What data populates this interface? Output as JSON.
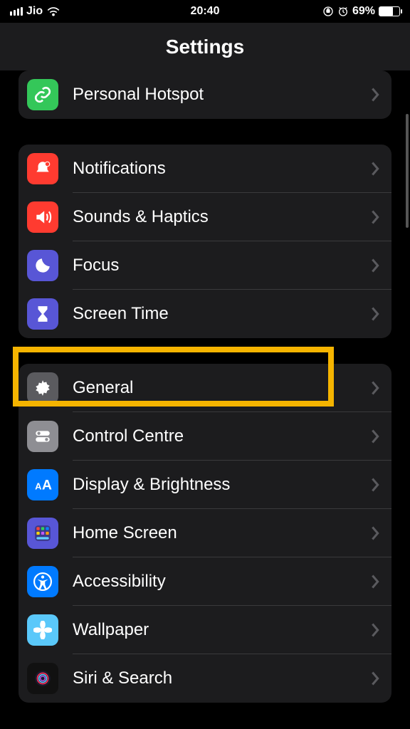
{
  "status": {
    "carrier": "Jio",
    "time": "20:40",
    "battery_pct": "69%",
    "battery_fill": "69%"
  },
  "header": {
    "title": "Settings"
  },
  "group1": {
    "items": [
      {
        "label": "Personal Hotspot",
        "icon": "link-icon",
        "color": "ic-green"
      }
    ]
  },
  "group2": {
    "items": [
      {
        "label": "Notifications",
        "icon": "bell-icon",
        "color": "ic-red"
      },
      {
        "label": "Sounds & Haptics",
        "icon": "speaker-icon",
        "color": "ic-red"
      },
      {
        "label": "Focus",
        "icon": "moon-icon",
        "color": "ic-indigo"
      },
      {
        "label": "Screen Time",
        "icon": "hourglass-icon",
        "color": "ic-indigo"
      }
    ]
  },
  "group3": {
    "items": [
      {
        "label": "General",
        "icon": "gear-icon",
        "color": "ic-dgray"
      },
      {
        "label": "Control Centre",
        "icon": "toggles-icon",
        "color": "ic-gray"
      },
      {
        "label": "Display & Brightness",
        "icon": "text-size-icon",
        "color": "ic-blue"
      },
      {
        "label": "Home Screen",
        "icon": "grid-icon",
        "color": "ic-indigo"
      },
      {
        "label": "Accessibility",
        "icon": "accessibility-icon",
        "color": "ic-blue"
      },
      {
        "label": "Wallpaper",
        "icon": "flower-icon",
        "color": "ic-cyan"
      },
      {
        "label": "Siri & Search",
        "icon": "siri-icon",
        "color": "ic-black"
      }
    ]
  },
  "highlight_index": 0
}
